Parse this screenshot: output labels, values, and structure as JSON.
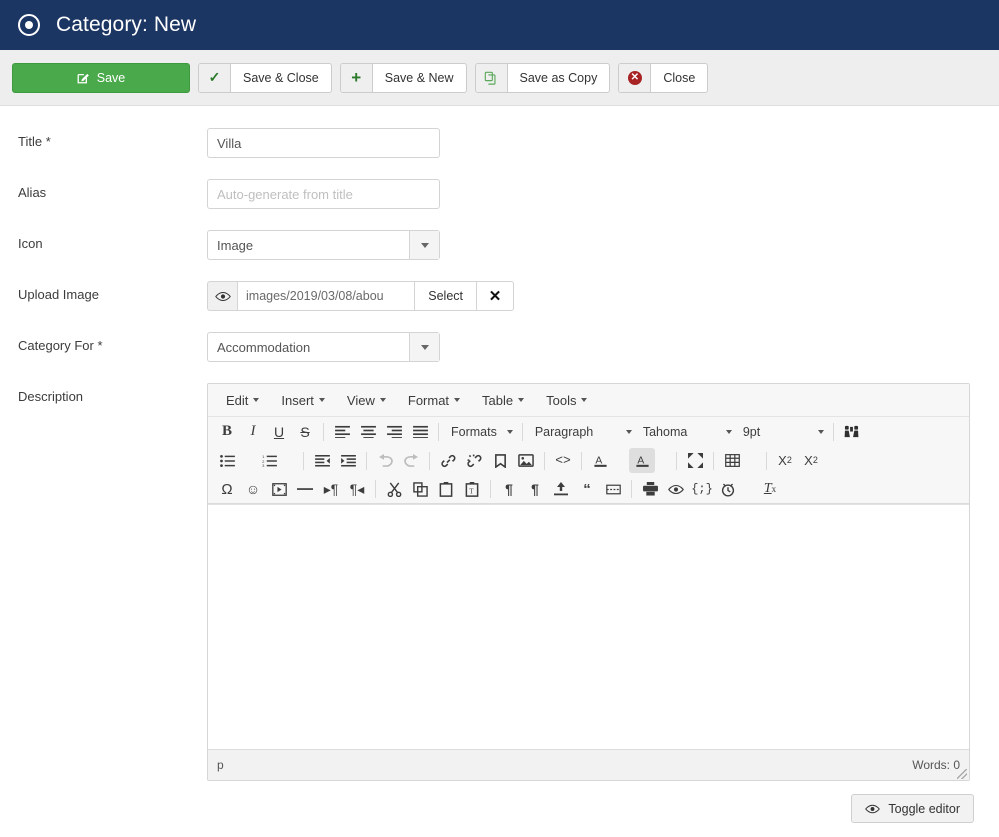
{
  "header": {
    "icon": "record-circle-icon",
    "title": "Category: New"
  },
  "toolbar": {
    "buttons": [
      {
        "label": "Save",
        "icon": "edit-square-icon",
        "style": "primary"
      },
      {
        "label": "Save & Close",
        "icon": "check-icon",
        "style": "default"
      },
      {
        "label": "Save & New",
        "icon": "plus-icon",
        "style": "default"
      },
      {
        "label": "Save as Copy",
        "icon": "copy-icon",
        "style": "default"
      },
      {
        "label": "Close",
        "icon": "close-circle-icon",
        "style": "default"
      }
    ]
  },
  "form": {
    "title": {
      "label": "Title *",
      "value": "Villa",
      "placeholder": ""
    },
    "alias": {
      "label": "Alias",
      "value": "",
      "placeholder": "Auto-generate from title"
    },
    "icon": {
      "label": "Icon",
      "value": "Image"
    },
    "upload_image": {
      "label": "Upload Image",
      "value": "images/2019/03/08/abou",
      "preview_icon": "eye-icon",
      "select_label": "Select",
      "clear_icon": "x-icon"
    },
    "category_for": {
      "label": "Category For *",
      "value": "Accommodation"
    },
    "description": {
      "label": "Description"
    }
  },
  "editor": {
    "menubar": [
      "Edit",
      "Insert",
      "View",
      "Format",
      "Table",
      "Tools"
    ],
    "row1": {
      "bold": "B",
      "italic": "I",
      "underline": "U",
      "strikethrough": "S",
      "formats_label": "Formats",
      "block_label": "Paragraph",
      "font_label": "Tahoma",
      "size_label": "9pt",
      "search_icon": "binoculars-icon"
    },
    "row2_icons": [
      "bullet-list-icon",
      "numbered-list-icon",
      "outdent-icon",
      "indent-icon",
      "undo-icon",
      "redo-icon",
      "link-icon",
      "unlink-icon",
      "anchor-icon",
      "image-icon",
      "source-code-icon",
      "text-color-icon",
      "background-color-icon",
      "fullscreen-icon",
      "table-icon",
      "subscript-icon",
      "superscript-icon"
    ],
    "row3_icons": [
      "special-character-icon",
      "emoticon-icon",
      "media-icon",
      "horizontal-rule-icon",
      "ltr-icon",
      "rtl-icon",
      "cut-icon",
      "copy-icon",
      "paste-icon",
      "paste-text-icon",
      "show-blocks-icon",
      "show-invisible-icon",
      "insert-file-icon",
      "blockquote-icon",
      "page-break-icon",
      "print-icon",
      "preview-icon",
      "code-sample-icon",
      "insert-date-time-icon",
      "clear-formatting-icon"
    ],
    "status": {
      "path": "p",
      "words": "Words: 0"
    }
  },
  "footer": {
    "toggle_editor": {
      "label": "Toggle editor",
      "icon": "eye-icon"
    }
  },
  "colors": {
    "header_bg": "#1c3664",
    "save_green": "#4aa94a",
    "toolbar_bg": "#eeeeee",
    "close_red": "#a82323",
    "editor_chrome": "#f7f7f7"
  }
}
